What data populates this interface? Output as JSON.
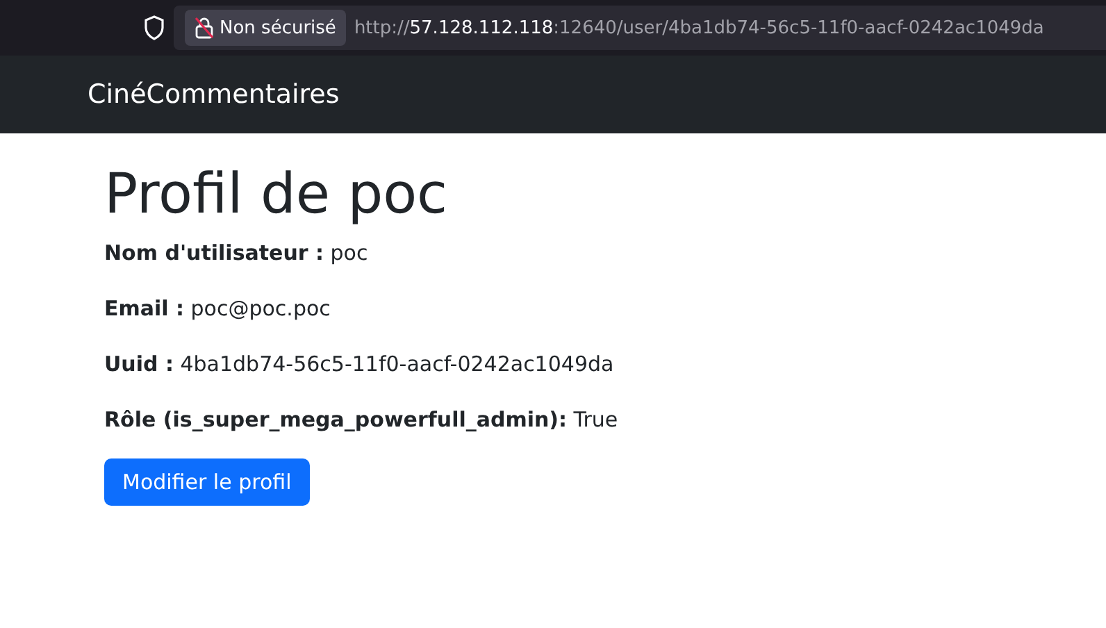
{
  "browser": {
    "security_label": "Non sécurisé",
    "url": {
      "scheme": "http://",
      "host": "57.128.112.118",
      "rest": ":12640/user/4ba1db74-56c5-11f0-aacf-0242ac1049da"
    }
  },
  "navbar": {
    "brand": "CinéCommentaires"
  },
  "profile": {
    "title": "Profil de poc",
    "fields": [
      {
        "text": "**Nom d'utilisateur :** poc"
      },
      {
        "text": "**Email :** poc@poc.poc"
      },
      {
        "text": "**Uuid :** 4ba1db74-56c5-11f0-aacf-0242ac1049da"
      },
      {
        "text": "**Rôle (is_super_mega_powerfull_admin):** True"
      }
    ],
    "button": "Modifier le profil"
  }
}
